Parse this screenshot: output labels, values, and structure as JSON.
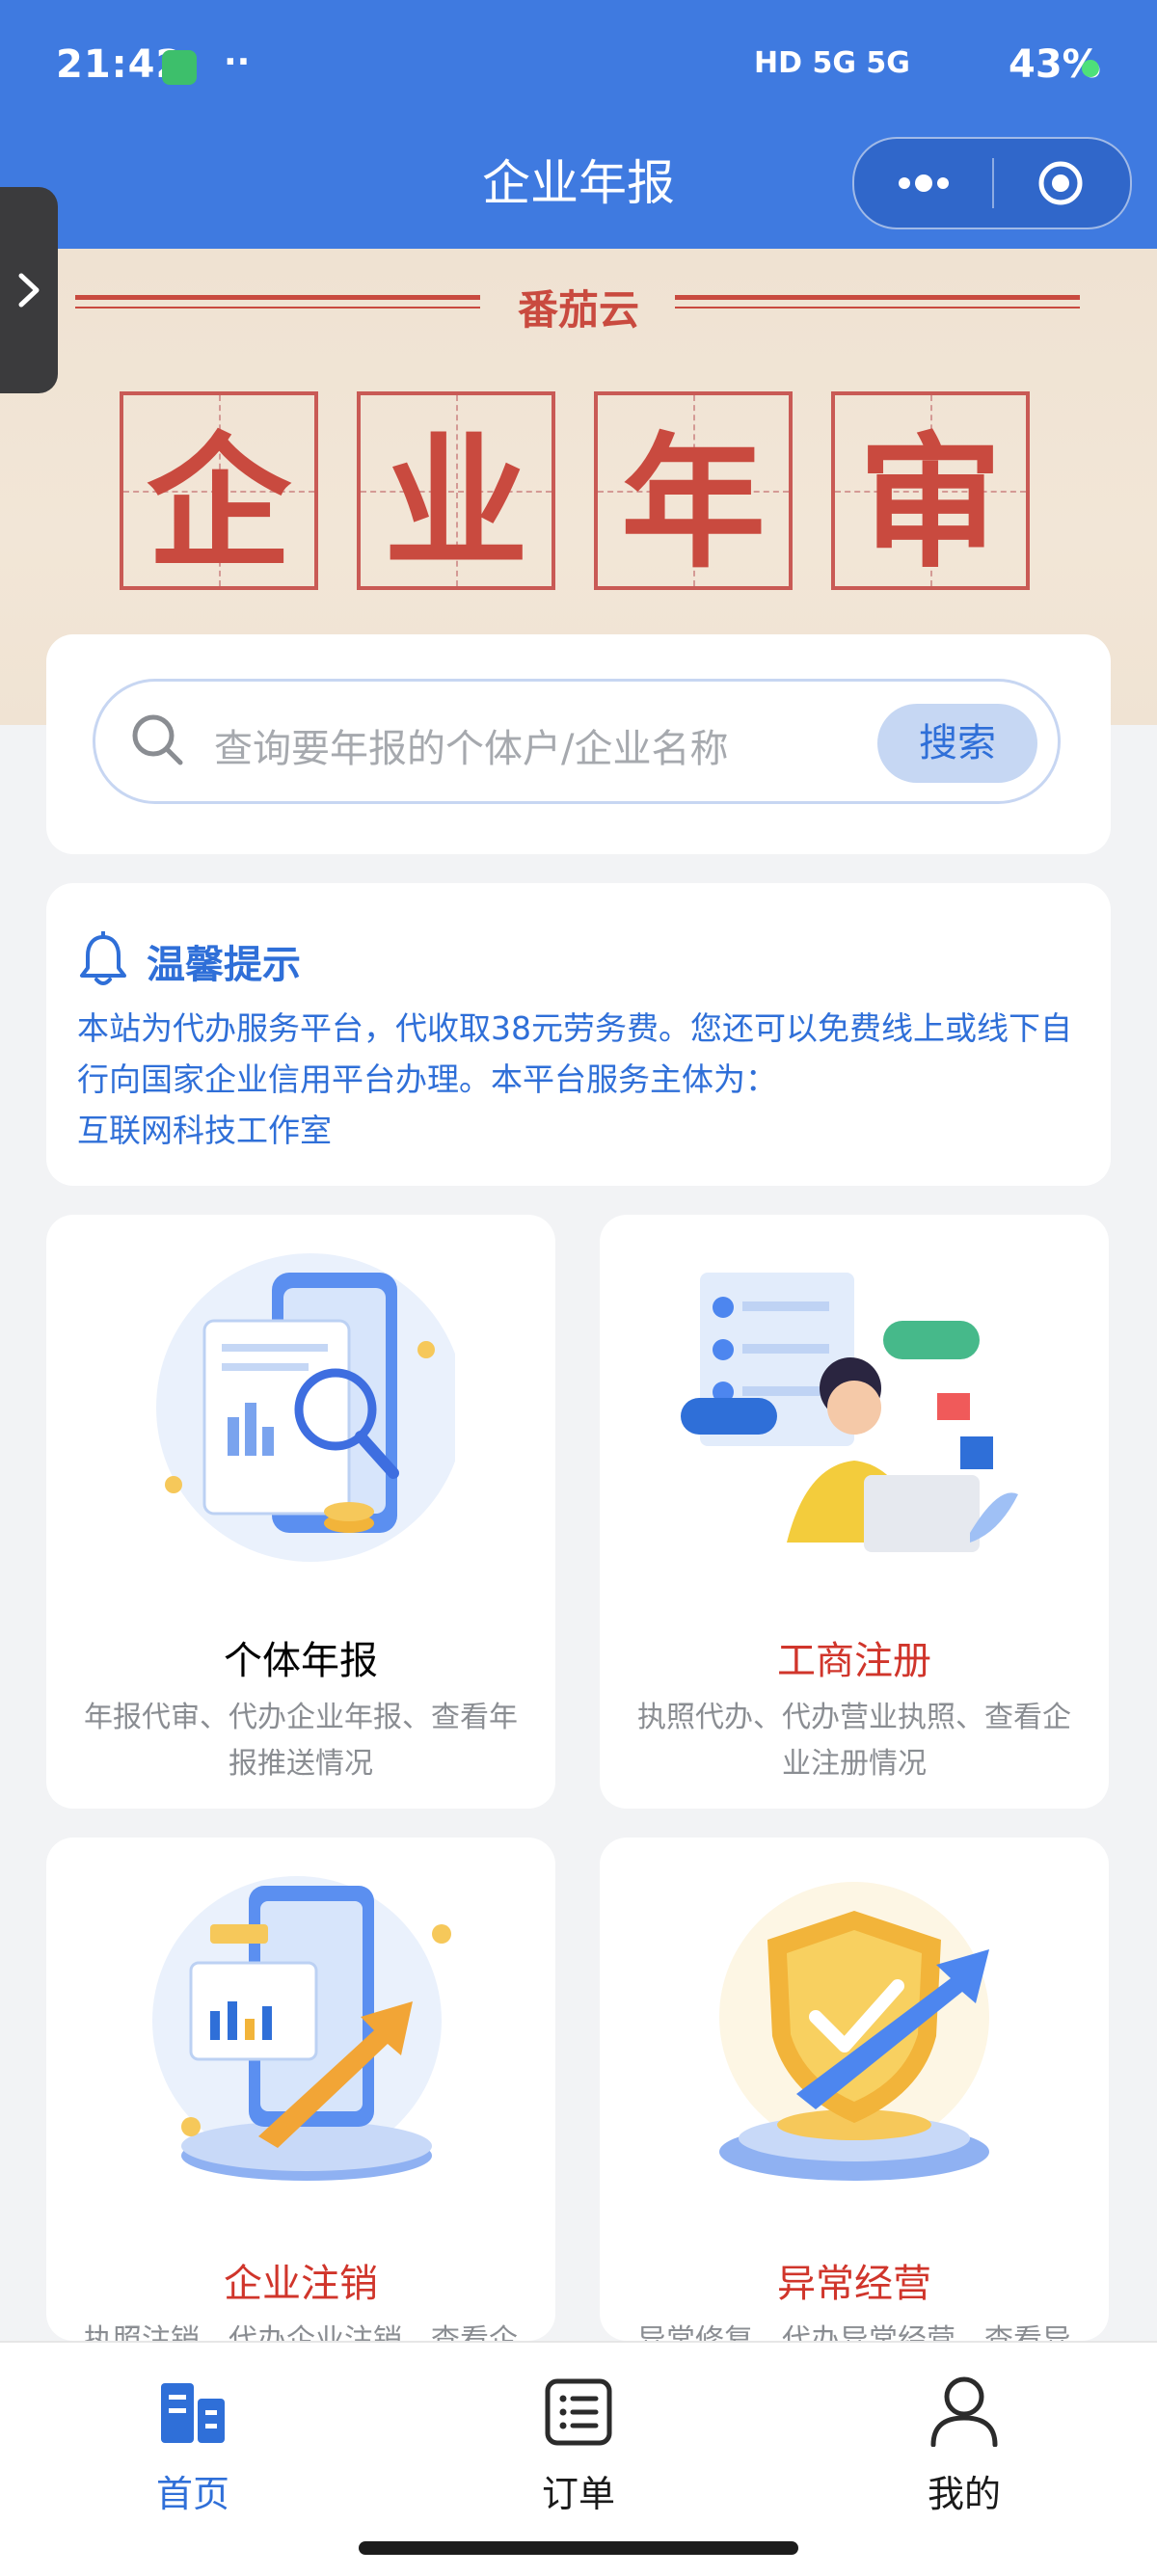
{
  "status_bar": {
    "time": "21:42",
    "dots": "··",
    "network": "HD 5G 5G",
    "battery": "43%"
  },
  "header": {
    "title": "企业年报",
    "capsule_icons": [
      "more-icon",
      "target-icon"
    ]
  },
  "banner": {
    "brand": "番茄云",
    "chars": [
      "企",
      "业",
      "年",
      "审"
    ]
  },
  "search": {
    "placeholder": "查询要年报的个体户/企业名称",
    "button": "搜索"
  },
  "notice": {
    "title": "温馨提示",
    "line1": "本站为代办服务平台，代收取38元劳务费。您还可以免费线上或线下自",
    "line2": "行向国家企业信用平台办理。本平台服务主体为：",
    "line3": "互联网科技工作室"
  },
  "services": [
    {
      "title": "个体年报",
      "desc1": "年报代审、代办企业年报、查看年",
      "desc2": "报推送情况",
      "color": "#1a1a1a"
    },
    {
      "title": "工商注册",
      "desc1": "执照代办、代办营业执照、查看企",
      "desc2": "业注册情况",
      "color": "#d0352b"
    },
    {
      "title": "企业注销",
      "desc1": "执照注销、代办企业注销、查看企",
      "desc2": "",
      "color": "#d0352b"
    },
    {
      "title": "异常经营",
      "desc1": "异常修复、代办异常经营、查看异",
      "desc2": "",
      "color": "#d0352b"
    }
  ],
  "nav": {
    "home": "首页",
    "orders": "订单",
    "mine": "我的",
    "active_color": "#2f6fd8"
  }
}
